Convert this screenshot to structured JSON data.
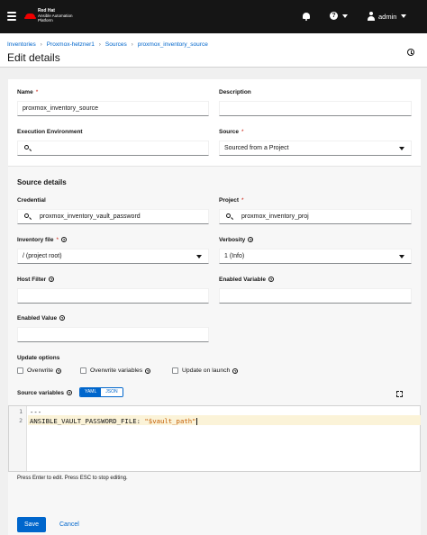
{
  "masthead": {
    "brand_line1": "Red Hat",
    "brand_line2": "Ansible Automation",
    "brand_line3": "Platform",
    "user": "admin"
  },
  "breadcrumb": [
    "Inventories",
    "Proxmox-hetzner1",
    "Sources",
    "proxmox_inventory_source"
  ],
  "page_title": "Edit details",
  "form": {
    "name_label": "Name",
    "name_value": "proxmox_inventory_source",
    "description_label": "Description",
    "description_value": "",
    "exec_env_label": "Execution Environment",
    "exec_env_value": "",
    "source_label": "Source",
    "source_value": "Sourced from a Project",
    "section_title": "Source details",
    "credential_label": "Credential",
    "credential_value": "proxmox_inventory_vault_password",
    "project_label": "Project",
    "project_value": "proxmox_inventory_proj",
    "inventory_file_label": "Inventory file",
    "inventory_file_value": "/ (project root)",
    "verbosity_label": "Verbosity",
    "verbosity_value": "1 (Info)",
    "host_filter_label": "Host Filter",
    "host_filter_value": "",
    "enabled_variable_label": "Enabled Variable",
    "enabled_variable_value": "",
    "enabled_value_label": "Enabled Value",
    "enabled_value_value": "",
    "update_options_label": "Update options",
    "overwrite_label": "Overwrite",
    "overwrite_variables_label": "Overwrite variables",
    "update_on_launch_label": "Update on launch",
    "source_variables_label": "Source variables",
    "yaml_label": "YAML",
    "json_label": "JSON",
    "code_line1": "---",
    "code_line2_key": "ANSIBLE_VAULT_PASSWORD_FILE: ",
    "code_line2_value": "\"$vault_path\"",
    "line_numbers": [
      "1",
      "2"
    ],
    "editor_hint": "Press Enter to edit. Press ESC to stop editing.",
    "required_mark": "*",
    "help_mark": "?"
  },
  "actions": {
    "save_label": "Save",
    "cancel_label": "Cancel"
  },
  "colors": {
    "masthead": "#151515",
    "primary": "#0066cc",
    "required": "#c9190b",
    "logo_red": "#ee0000"
  },
  "icons": [
    "hamburger-icon",
    "bell-icon",
    "help-icon",
    "user-icon",
    "history-icon",
    "search-icon",
    "chevron-down-icon",
    "expand-icon"
  ]
}
